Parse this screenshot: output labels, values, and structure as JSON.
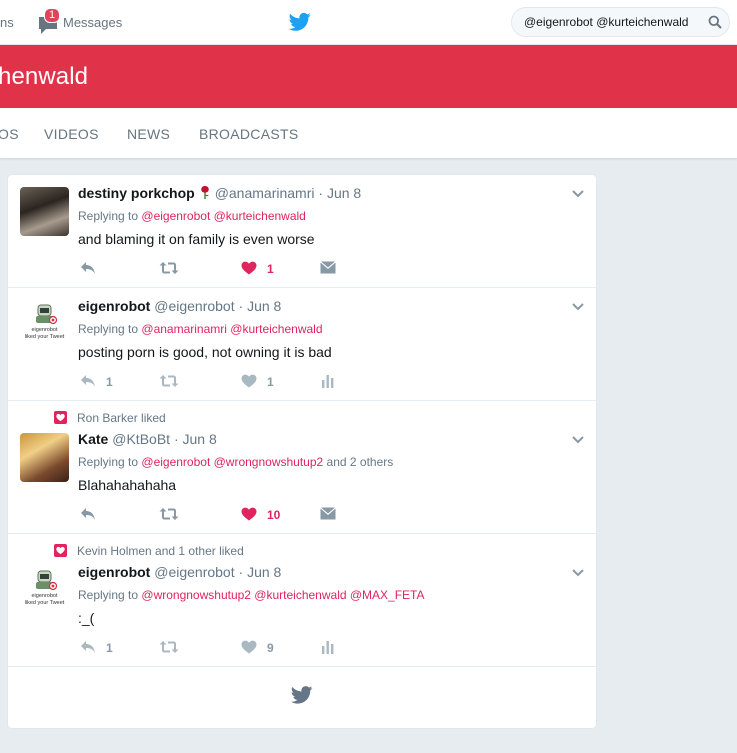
{
  "nav": {
    "partial_label": "ns",
    "messages_label": "Messages",
    "messages_badge": "1",
    "search_value": "@eigenrobot @kurteichenwald",
    "brand_color": "#1da1f2"
  },
  "header": {
    "title": "henwald",
    "color": "#e0334a"
  },
  "tabs": [
    "OS",
    "VIDEOS",
    "NEWS",
    "BROADCASTS"
  ],
  "tweets": [
    {
      "context": "",
      "name": "destiny porkchop",
      "handle": "@anamarinamri",
      "date": "Jun 8",
      "replying_label": "Replying to",
      "mentions": "@eigenrobot @kurteichenwald",
      "extra": "",
      "text": "and blaming it on family is even worse",
      "reply_count": "",
      "like_count": "1",
      "liked": true
    },
    {
      "context": "",
      "name": "eigenrobot",
      "handle": "@eigenrobot",
      "date": "Jun 8",
      "replying_label": "Replying to",
      "mentions": "@anamarinamri @kurteichenwald",
      "extra": "",
      "text": "posting porn is good, not owning it is bad",
      "reply_count": "1",
      "like_count": "1",
      "liked": false,
      "avatar_caption": "eigenrobot liked your Tweet"
    },
    {
      "context": "Ron Barker liked",
      "name": "Kate",
      "handle": "@KtBoBt",
      "date": "Jun 8",
      "replying_label": "Replying to",
      "mentions": "@eigenrobot @wrongnowshutup2",
      "extra": "and 2 others",
      "text": "Blahahahahaha",
      "reply_count": "",
      "like_count": "10",
      "liked": true
    },
    {
      "context": "Kevin Holmen and 1 other liked",
      "name": "eigenrobot",
      "handle": "@eigenrobot",
      "date": "Jun 8",
      "replying_label": "Replying to",
      "mentions": "@wrongnowshutup2 @kurteichenwald @MAX_FETA",
      "extra": "",
      "text": ":_(",
      "reply_count": "1",
      "like_count": "9",
      "liked": false,
      "avatar_caption": "eigenrobot liked your Tweet"
    }
  ],
  "icons": {
    "reply": "reply-icon",
    "retweet": "retweet-icon",
    "like": "heart-icon",
    "dm": "envelope-icon",
    "analytics": "analytics-icon"
  }
}
